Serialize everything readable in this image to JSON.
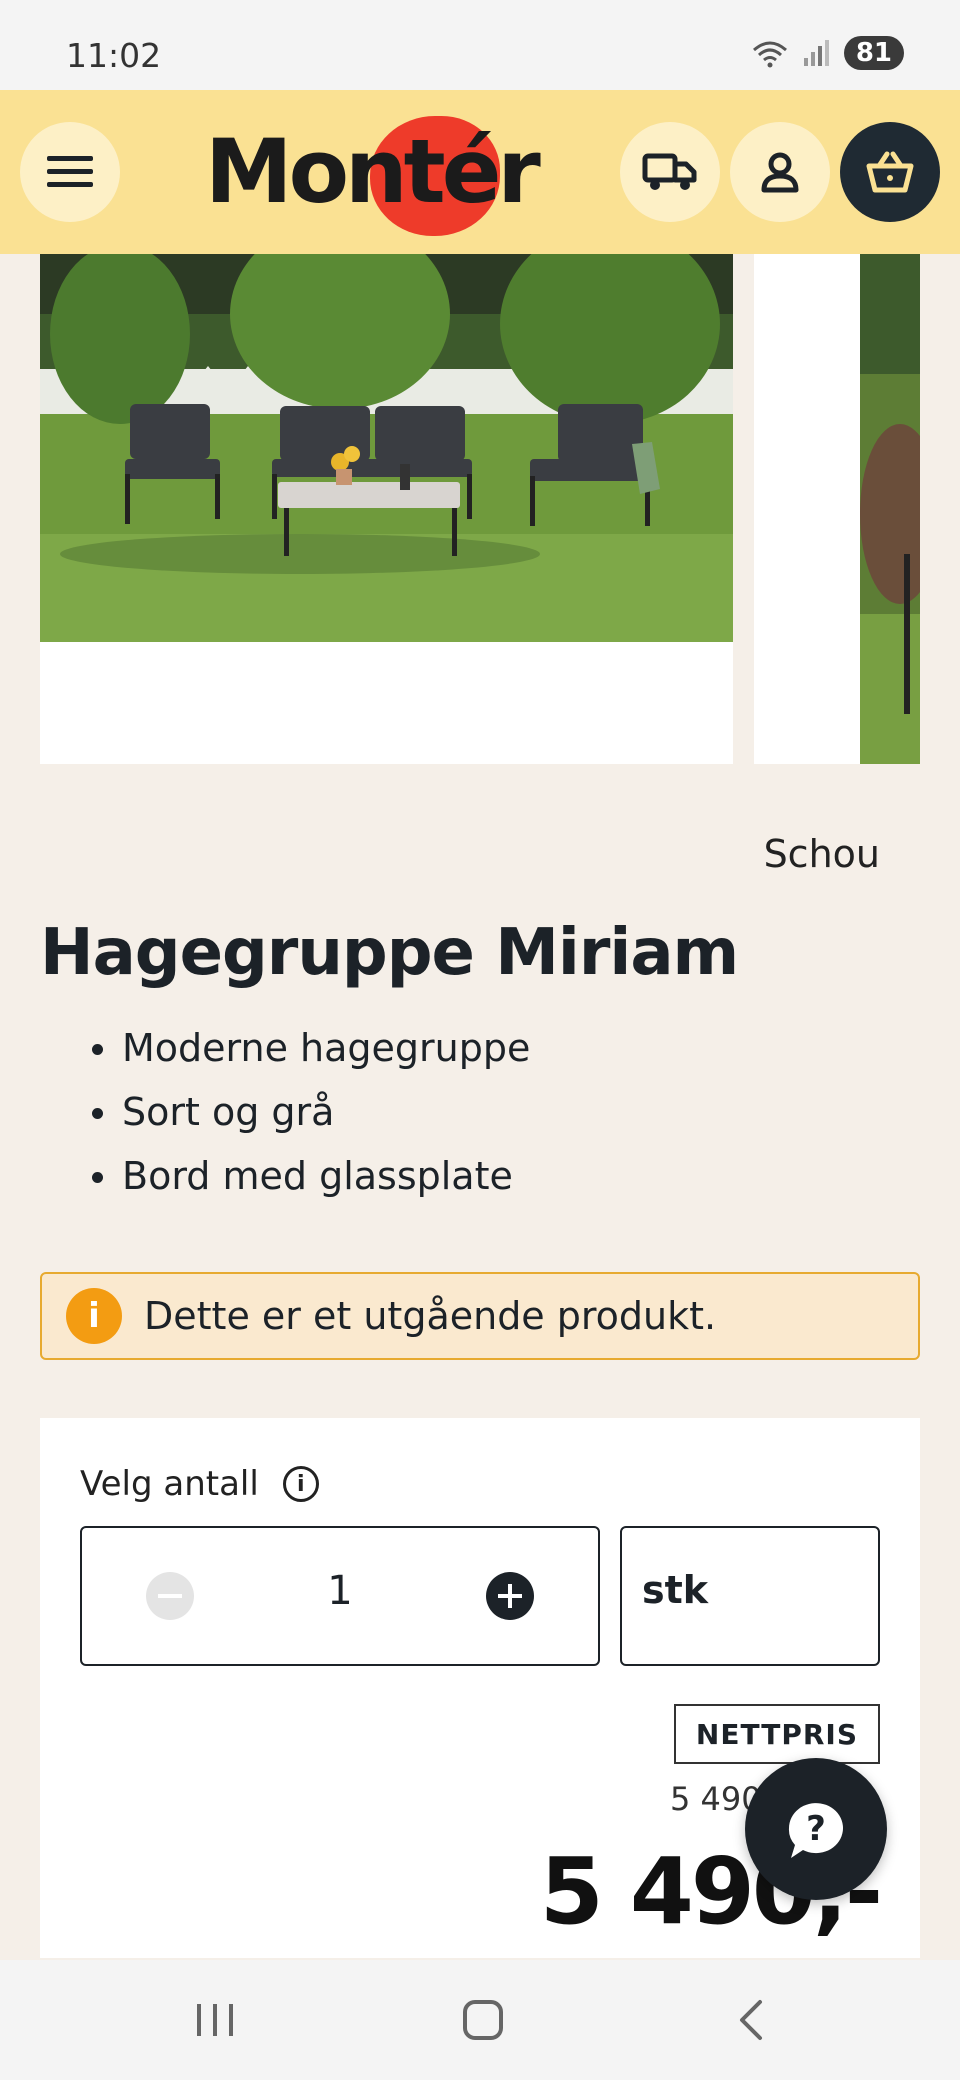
{
  "status_bar": {
    "time": "11:02",
    "battery": "81",
    "wifi_label": "5"
  },
  "header": {
    "logo_text": "Montér",
    "icons": [
      "menu-icon",
      "truck-icon",
      "user-icon",
      "cart-icon"
    ]
  },
  "product": {
    "brand": "Schou",
    "title": "Hagegruppe Miriam",
    "bullets": [
      "Moderne hagegruppe",
      "Sort og grå",
      "Bord med glassplate"
    ],
    "notice": "Dette er et utgående produkt."
  },
  "purchase": {
    "quantity_label": "Velg antall",
    "quantity": "1",
    "unit": "stk",
    "price_badge": "NETTPRIS",
    "old_price": "5 490",
    "price": "5 490,-"
  },
  "colors": {
    "header_bg": "#fae193",
    "page_bg": "#f5efe8",
    "accent_red": "#ee3b2a",
    "notice_orange": "#f39c12",
    "dark": "#1c2228"
  }
}
